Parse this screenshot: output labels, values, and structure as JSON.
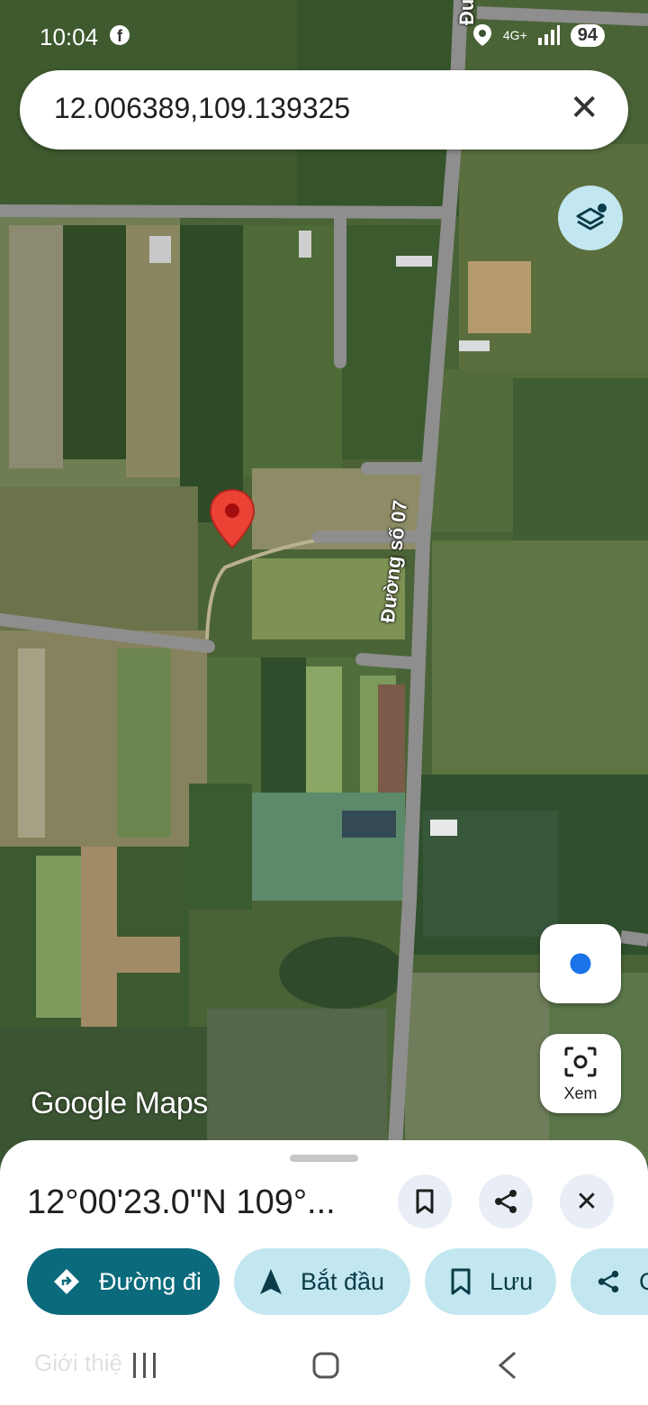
{
  "status_bar": {
    "time": "10:04",
    "network": "4G+",
    "battery": "94"
  },
  "search": {
    "query": "12.006389,109.139325"
  },
  "map": {
    "road_label": "Đường số 07",
    "road_label_top": "Đư",
    "logo": "Google Maps",
    "marker_color": "#ea4335"
  },
  "controls": {
    "view_label": "Xem"
  },
  "sheet": {
    "title": "12°00'23.0\"N 109°...",
    "chips": [
      {
        "label": "Đường đi",
        "icon": "directions-icon"
      },
      {
        "label": "Bắt đầu",
        "icon": "navigation-icon"
      },
      {
        "label": "Lưu",
        "icon": "bookmark-icon"
      },
      {
        "label": "C",
        "icon": "share-icon"
      }
    ],
    "behind_text": "Giới thiệ"
  },
  "colors": {
    "primary": "#0b6a7b",
    "chip_bg": "#c2e7f0",
    "blue_dot": "#1a73e8"
  }
}
